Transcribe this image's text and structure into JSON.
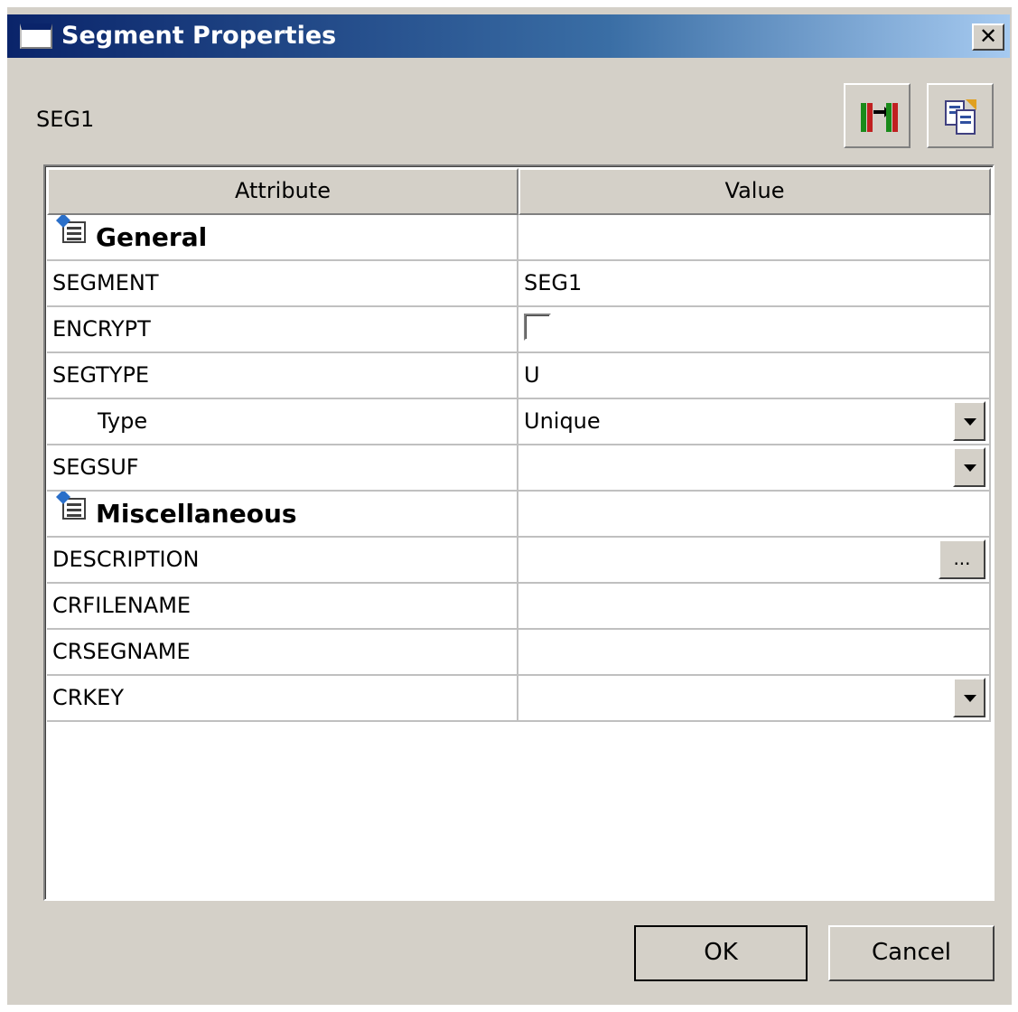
{
  "window": {
    "title": "Segment Properties",
    "close_label": "✕"
  },
  "header": {
    "segment_name": "SEG1"
  },
  "toolbar": {
    "buttons": [
      {
        "icon": "column-layout-icon"
      },
      {
        "icon": "copy-export-icon"
      }
    ]
  },
  "grid": {
    "columns": {
      "attribute": "Attribute",
      "value": "Value"
    },
    "categories": {
      "general": "General",
      "misc": "Miscellaneous"
    },
    "rows": {
      "segment": {
        "attr": "SEGMENT",
        "value": "SEG1"
      },
      "encrypt": {
        "attr": "ENCRYPT",
        "checked": false
      },
      "segtype": {
        "attr": "SEGTYPE",
        "value": "U"
      },
      "type": {
        "attr": "Type",
        "value": "Unique"
      },
      "segsuf": {
        "attr": "SEGSUF",
        "value": ""
      },
      "description": {
        "attr": "DESCRIPTION",
        "value": "",
        "button": "..."
      },
      "crfilename": {
        "attr": "CRFILENAME",
        "value": ""
      },
      "crsegname": {
        "attr": "CRSEGNAME",
        "value": ""
      },
      "crkey": {
        "attr": "CRKEY",
        "value": ""
      }
    }
  },
  "footer": {
    "ok": "OK",
    "cancel": "Cancel"
  }
}
